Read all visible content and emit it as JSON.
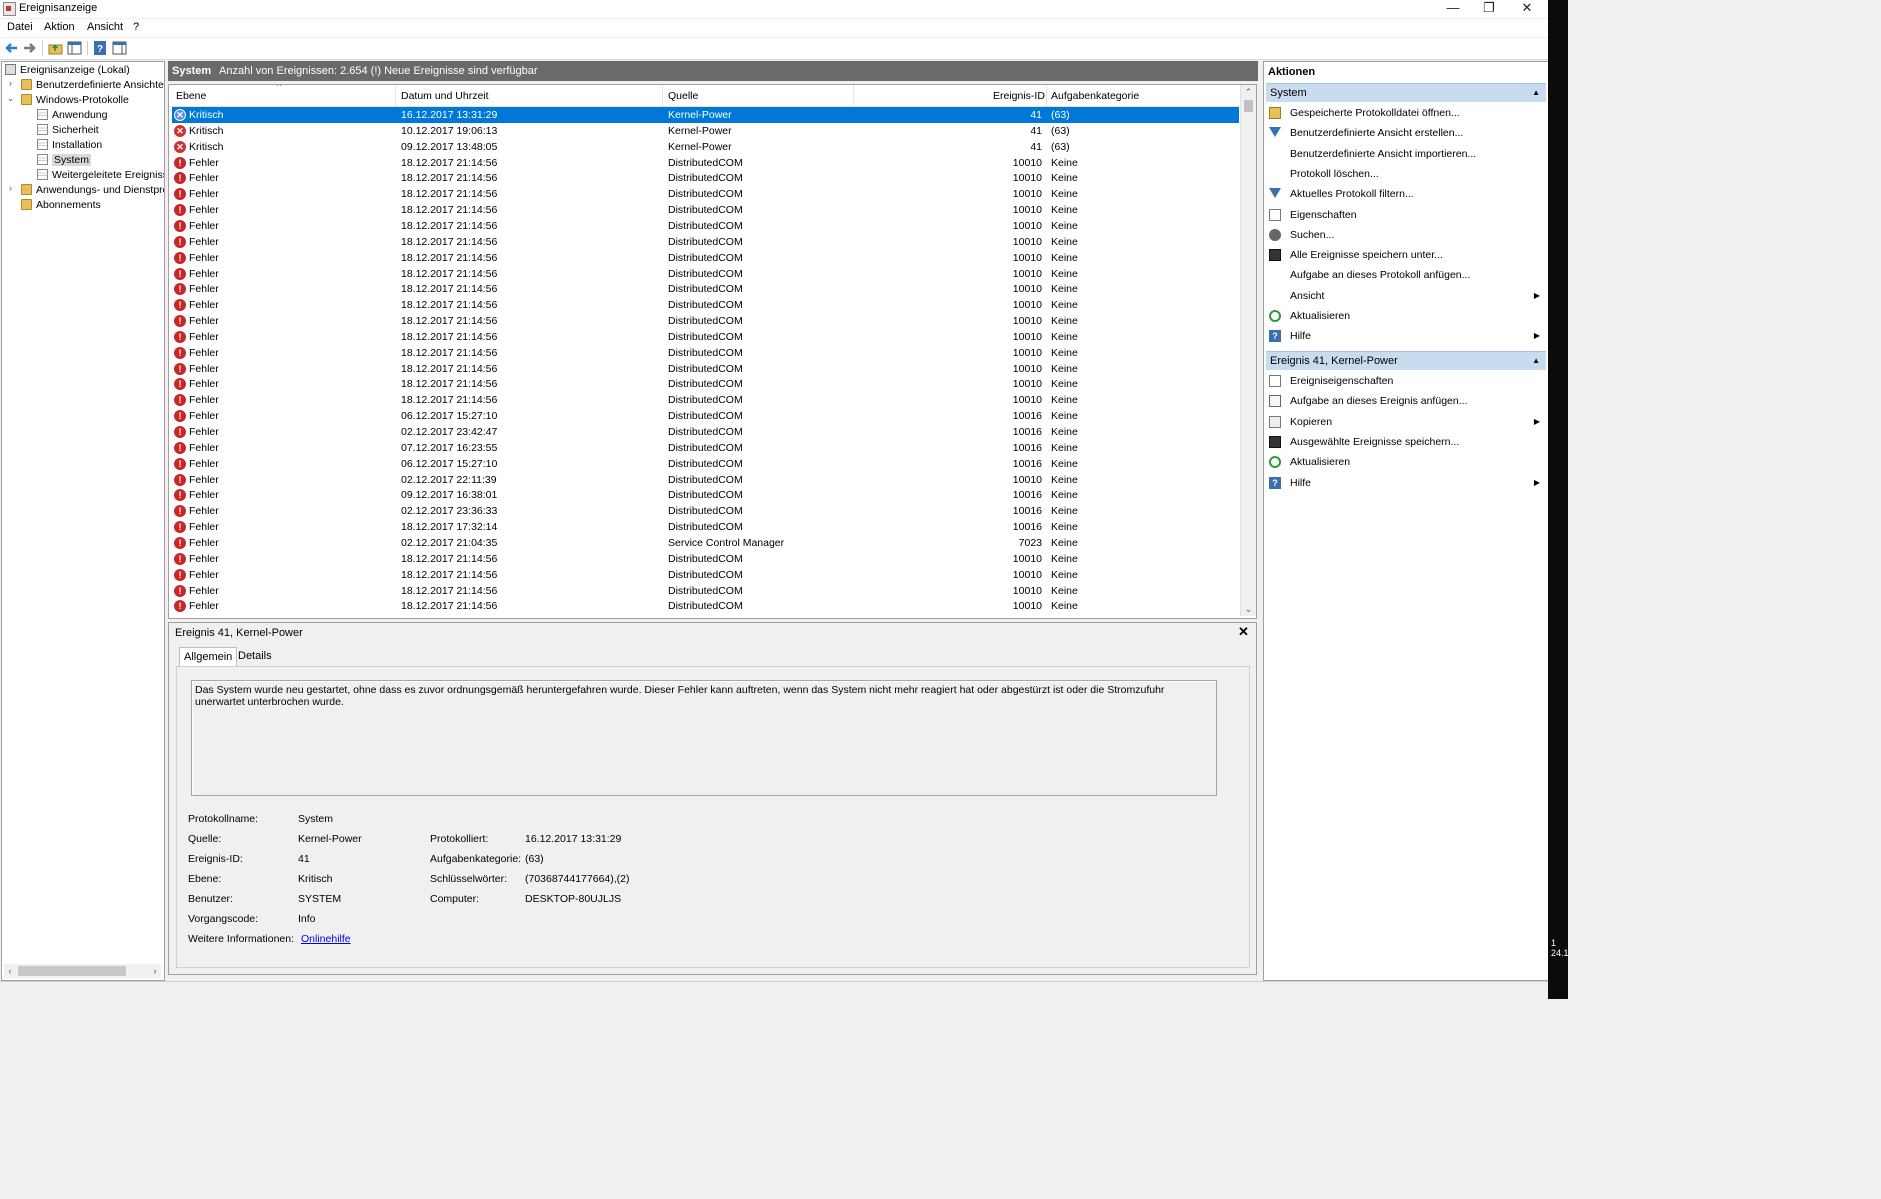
{
  "window": {
    "title": "Ereignisanzeige",
    "minimize": "—",
    "restore": "❐",
    "close": "✕"
  },
  "menu": [
    "Datei",
    "Aktion",
    "Ansicht",
    "?"
  ],
  "tree": {
    "root": "Ereignisanzeige (Lokal)",
    "custom_views": "Benutzerdefinierte Ansichten",
    "windows_logs": "Windows-Protokolle",
    "logs": [
      "Anwendung",
      "Sicherheit",
      "Installation",
      "System",
      "Weitergeleitete Ereignisse"
    ],
    "app_services": "Anwendungs- und Dienstprotokolle",
    "subscriptions": "Abonnements"
  },
  "center": {
    "title": "System",
    "count_text": "Anzahl von Ereignissen: 2.654 (!) Neue Ereignisse sind verfügbar"
  },
  "columns": {
    "level": "Ebene",
    "datetime": "Datum und Uhrzeit",
    "source": "Quelle",
    "event_id": "Ereignis-ID",
    "task_category": "Aufgabenkategorie"
  },
  "events": [
    {
      "level": "Kritisch",
      "datetime": "16.12.2017 13:31:29",
      "source": "Kernel-Power",
      "id": "41",
      "category": "(63)"
    },
    {
      "level": "Kritisch",
      "datetime": "10.12.2017 19:06:13",
      "source": "Kernel-Power",
      "id": "41",
      "category": "(63)"
    },
    {
      "level": "Kritisch",
      "datetime": "09.12.2017 13:48:05",
      "source": "Kernel-Power",
      "id": "41",
      "category": "(63)"
    },
    {
      "level": "Fehler",
      "datetime": "18.12.2017 21:14:56",
      "source": "DistributedCOM",
      "id": "10010",
      "category": "Keine"
    },
    {
      "level": "Fehler",
      "datetime": "18.12.2017 21:14:56",
      "source": "DistributedCOM",
      "id": "10010",
      "category": "Keine"
    },
    {
      "level": "Fehler",
      "datetime": "18.12.2017 21:14:56",
      "source": "DistributedCOM",
      "id": "10010",
      "category": "Keine"
    },
    {
      "level": "Fehler",
      "datetime": "18.12.2017 21:14:56",
      "source": "DistributedCOM",
      "id": "10010",
      "category": "Keine"
    },
    {
      "level": "Fehler",
      "datetime": "18.12.2017 21:14:56",
      "source": "DistributedCOM",
      "id": "10010",
      "category": "Keine"
    },
    {
      "level": "Fehler",
      "datetime": "18.12.2017 21:14:56",
      "source": "DistributedCOM",
      "id": "10010",
      "category": "Keine"
    },
    {
      "level": "Fehler",
      "datetime": "18.12.2017 21:14:56",
      "source": "DistributedCOM",
      "id": "10010",
      "category": "Keine"
    },
    {
      "level": "Fehler",
      "datetime": "18.12.2017 21:14:56",
      "source": "DistributedCOM",
      "id": "10010",
      "category": "Keine"
    },
    {
      "level": "Fehler",
      "datetime": "18.12.2017 21:14:56",
      "source": "DistributedCOM",
      "id": "10010",
      "category": "Keine"
    },
    {
      "level": "Fehler",
      "datetime": "18.12.2017 21:14:56",
      "source": "DistributedCOM",
      "id": "10010",
      "category": "Keine"
    },
    {
      "level": "Fehler",
      "datetime": "18.12.2017 21:14:56",
      "source": "DistributedCOM",
      "id": "10010",
      "category": "Keine"
    },
    {
      "level": "Fehler",
      "datetime": "18.12.2017 21:14:56",
      "source": "DistributedCOM",
      "id": "10010",
      "category": "Keine"
    },
    {
      "level": "Fehler",
      "datetime": "18.12.2017 21:14:56",
      "source": "DistributedCOM",
      "id": "10010",
      "category": "Keine"
    },
    {
      "level": "Fehler",
      "datetime": "18.12.2017 21:14:56",
      "source": "DistributedCOM",
      "id": "10010",
      "category": "Keine"
    },
    {
      "level": "Fehler",
      "datetime": "18.12.2017 21:14:56",
      "source": "DistributedCOM",
      "id": "10010",
      "category": "Keine"
    },
    {
      "level": "Fehler",
      "datetime": "18.12.2017 21:14:56",
      "source": "DistributedCOM",
      "id": "10010",
      "category": "Keine"
    },
    {
      "level": "Fehler",
      "datetime": "06.12.2017 15:27:10",
      "source": "DistributedCOM",
      "id": "10016",
      "category": "Keine"
    },
    {
      "level": "Fehler",
      "datetime": "02.12.2017 23:42:47",
      "source": "DistributedCOM",
      "id": "10016",
      "category": "Keine"
    },
    {
      "level": "Fehler",
      "datetime": "07.12.2017 16:23:55",
      "source": "DistributedCOM",
      "id": "10016",
      "category": "Keine"
    },
    {
      "level": "Fehler",
      "datetime": "06.12.2017 15:27:10",
      "source": "DistributedCOM",
      "id": "10016",
      "category": "Keine"
    },
    {
      "level": "Fehler",
      "datetime": "02.12.2017 22:11:39",
      "source": "DistributedCOM",
      "id": "10010",
      "category": "Keine"
    },
    {
      "level": "Fehler",
      "datetime": "09.12.2017 16:38:01",
      "source": "DistributedCOM",
      "id": "10016",
      "category": "Keine"
    },
    {
      "level": "Fehler",
      "datetime": "02.12.2017 23:36:33",
      "source": "DistributedCOM",
      "id": "10016",
      "category": "Keine"
    },
    {
      "level": "Fehler",
      "datetime": "18.12.2017 17:32:14",
      "source": "DistributedCOM",
      "id": "10016",
      "category": "Keine"
    },
    {
      "level": "Fehler",
      "datetime": "02.12.2017 21:04:35",
      "source": "Service Control Manager",
      "id": "7023",
      "category": "Keine"
    },
    {
      "level": "Fehler",
      "datetime": "18.12.2017 21:14:56",
      "source": "DistributedCOM",
      "id": "10010",
      "category": "Keine"
    },
    {
      "level": "Fehler",
      "datetime": "18.12.2017 21:14:56",
      "source": "DistributedCOM",
      "id": "10010",
      "category": "Keine"
    },
    {
      "level": "Fehler",
      "datetime": "18.12.2017 21:14:56",
      "source": "DistributedCOM",
      "id": "10010",
      "category": "Keine"
    },
    {
      "level": "Fehler",
      "datetime": "18.12.2017 21:14:56",
      "source": "DistributedCOM",
      "id": "10010",
      "category": "Keine"
    }
  ],
  "detail": {
    "title": "Ereignis 41, Kernel-Power",
    "close": "✕",
    "tabs": [
      "Allgemein",
      "Details"
    ],
    "description": "Das System wurde neu gestartet, ohne dass es zuvor ordnungsgemäß heruntergefahren wurde. Dieser Fehler kann auftreten, wenn das System nicht mehr reagiert hat oder abgestürzt ist oder die Stromzufuhr unerwartet unterbrochen wurde.",
    "props": {
      "log_name_label": "Protokollname:",
      "log_name": "System",
      "source_label": "Quelle:",
      "source": "Kernel-Power",
      "logged_label": "Protokolliert:",
      "logged": "16.12.2017 13:31:29",
      "event_id_label": "Ereignis-ID:",
      "event_id": "41",
      "task_label": "Aufgabenkategorie:",
      "task": "(63)",
      "level_label": "Ebene:",
      "level": "Kritisch",
      "keywords_label": "Schlüsselwörter:",
      "keywords": "(70368744177664),(2)",
      "user_label": "Benutzer:",
      "user": "SYSTEM",
      "computer_label": "Computer:",
      "computer": "DESKTOP-80UJLJS",
      "opcode_label": "Vorgangscode:",
      "opcode": "Info",
      "more_info_label": "Weitere Informationen:",
      "more_info_link": "Onlinehilfe"
    }
  },
  "actions": {
    "title": "Aktionen",
    "system_section": "System",
    "system_items": [
      {
        "label": "Gespeicherte Protokolldatei öffnen...",
        "icon": "open-folder-icon"
      },
      {
        "label": "Benutzerdefinierte Ansicht erstellen...",
        "icon": "filter-icon"
      },
      {
        "label": "Benutzerdefinierte Ansicht importieren...",
        "icon": ""
      },
      {
        "label": "Protokoll löschen...",
        "icon": ""
      },
      {
        "label": "Aktuelles Protokoll filtern...",
        "icon": "filter-icon"
      },
      {
        "label": "Eigenschaften",
        "icon": "properties-icon"
      },
      {
        "label": "Suchen...",
        "icon": "find-icon"
      },
      {
        "label": "Alle Ereignisse speichern unter...",
        "icon": "save-icon"
      },
      {
        "label": "Aufgabe an dieses Protokoll anfügen...",
        "icon": ""
      },
      {
        "label": "Ansicht",
        "icon": "",
        "submenu": true
      },
      {
        "label": "Aktualisieren",
        "icon": "refresh-icon"
      },
      {
        "label": "Hilfe",
        "icon": "help-icon",
        "submenu": true
      }
    ],
    "event_section": "Ereignis 41, Kernel-Power",
    "event_items": [
      {
        "label": "Ereigniseigenschaften",
        "icon": "properties-icon"
      },
      {
        "label": "Aufgabe an dieses Ereignis anfügen...",
        "icon": "task-icon"
      },
      {
        "label": "Kopieren",
        "icon": "copy-icon",
        "submenu": true
      },
      {
        "label": "Ausgewählte Ereignisse speichern...",
        "icon": "save-icon"
      },
      {
        "label": "Aktualisieren",
        "icon": "refresh-icon"
      },
      {
        "label": "Hilfe",
        "icon": "help-icon",
        "submenu": true
      }
    ]
  },
  "desktop": {
    "clock": "1\n24.1"
  },
  "colors": {
    "selection": "#0078d7",
    "section_header": "#c9dcef",
    "center_header": "#6a6a6a",
    "critical": "#d32f2f",
    "link": "#0000ee"
  }
}
